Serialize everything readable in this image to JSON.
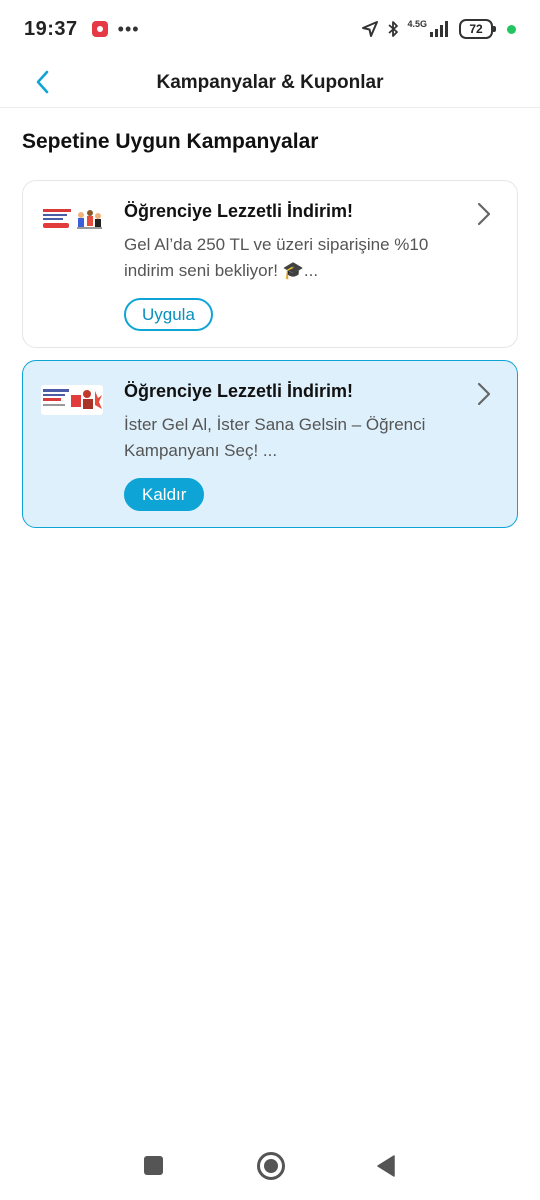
{
  "status": {
    "time": "19:37",
    "network_label": "4.5G",
    "battery": "72"
  },
  "header": {
    "title": "Kampanyalar & Kuponlar"
  },
  "section": {
    "title": "Sepetine Uygun Kampanyalar"
  },
  "campaigns": [
    {
      "title": "Öğrenciye Lezzetli İndirim!",
      "description": "Gel Al’da 250 TL ve üzeri siparişine %10 indirim seni bekliyor! 🎓...",
      "button_label": "Uygula",
      "selected": false
    },
    {
      "title": "Öğrenciye Lezzetli İndirim!",
      "description": "İster Gel Al, İster Sana Gelsin – Öğrenci Kampanyanı Seç! ...",
      "button_label": "Kaldır",
      "selected": true
    }
  ],
  "icons": {
    "back": "chevron-left-icon",
    "card_arrow": "chevron-right-icon"
  },
  "colors": {
    "accent": "#0ea5d6",
    "selected_card_bg": "#def0fb",
    "status_green": "#22c55e"
  }
}
